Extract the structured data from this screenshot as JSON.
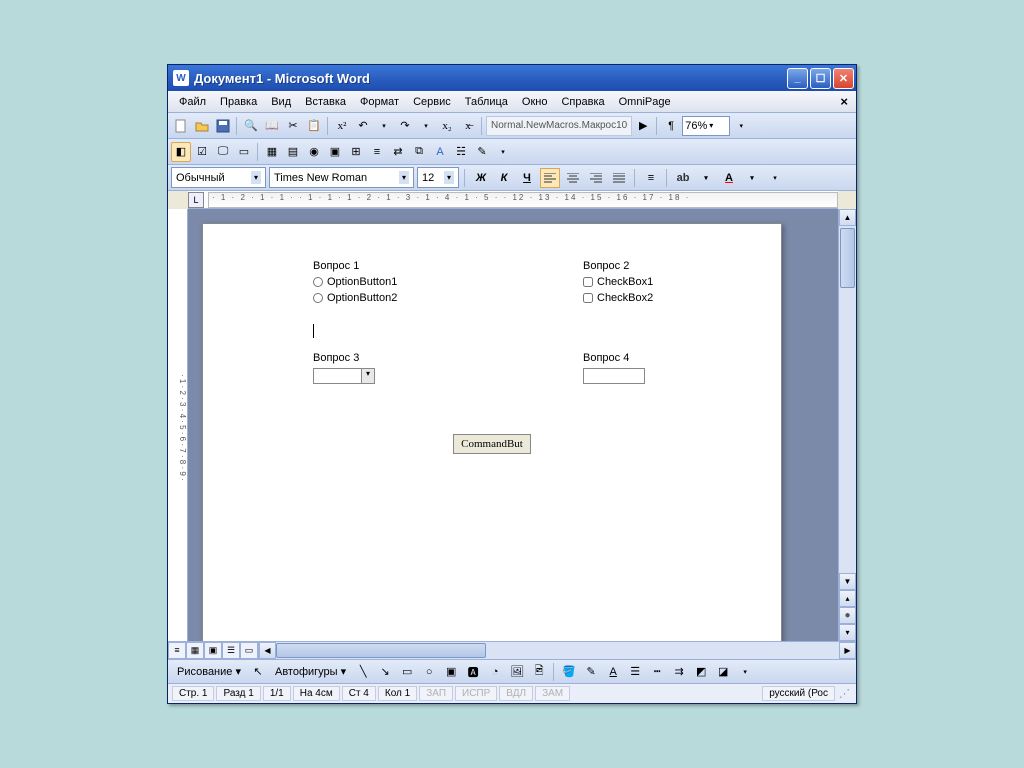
{
  "title": "Документ1 - Microsoft Word",
  "menu": [
    "Файл",
    "Правка",
    "Вид",
    "Вставка",
    "Формат",
    "Сервис",
    "Таблица",
    "Окно",
    "Справка",
    "OmniPage"
  ],
  "macro_name": "Normal.NewMacros.Макрос10",
  "zoom": "76%",
  "format": {
    "style": "Обычный",
    "font": "Times New Roman",
    "size": "12"
  },
  "ruler_h": "· 1 · 2 · 1 · 1 ·   · 1 · 1 · 1 · 2 · 1 · 3 · 1 · 4 · 1 · 5 ·                                           · 12 · 13 · 14 · 15 · 16 · 17 · 18 ·",
  "doc": {
    "q1": {
      "title": "Вопрос 1",
      "opt1": "OptionButton1",
      "opt2": "OptionButton2"
    },
    "q2": {
      "title": "Вопрос 2",
      "chk1": "CheckBox1",
      "chk2": "CheckBox2"
    },
    "q3": {
      "title": "Вопрос 3"
    },
    "q4": {
      "title": "Вопрос 4"
    },
    "button": "CommandBut"
  },
  "draw": {
    "menu": "Рисование ▾",
    "autoshapes": "Автофигуры ▾"
  },
  "status": {
    "page": "Стр. 1",
    "section": "Разд 1",
    "pages": "1/1",
    "at": "На 4см",
    "line": "Ст 4",
    "col": "Кол 1",
    "rec": "ЗАП",
    "trk": "ИСПР",
    "ext": "ВДЛ",
    "ovr": "ЗАМ",
    "lang": "русский (Рос"
  }
}
